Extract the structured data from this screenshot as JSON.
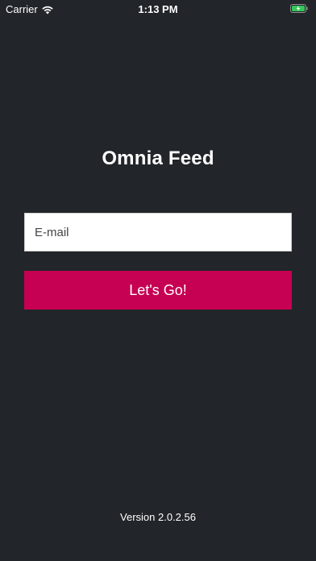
{
  "status_bar": {
    "carrier": "Carrier",
    "time": "1:13 PM",
    "icons": [
      "wifi-icon",
      "battery-charging-icon"
    ],
    "battery_color": "#34c759"
  },
  "app": {
    "title": "Omnia Feed",
    "email_placeholder": "E-mail",
    "email_value": "",
    "button_label": "Let's Go!",
    "version": "Version 2.0.2.56"
  },
  "colors": {
    "background": "#222529",
    "accent": "#c60052",
    "text": "#ffffff"
  }
}
